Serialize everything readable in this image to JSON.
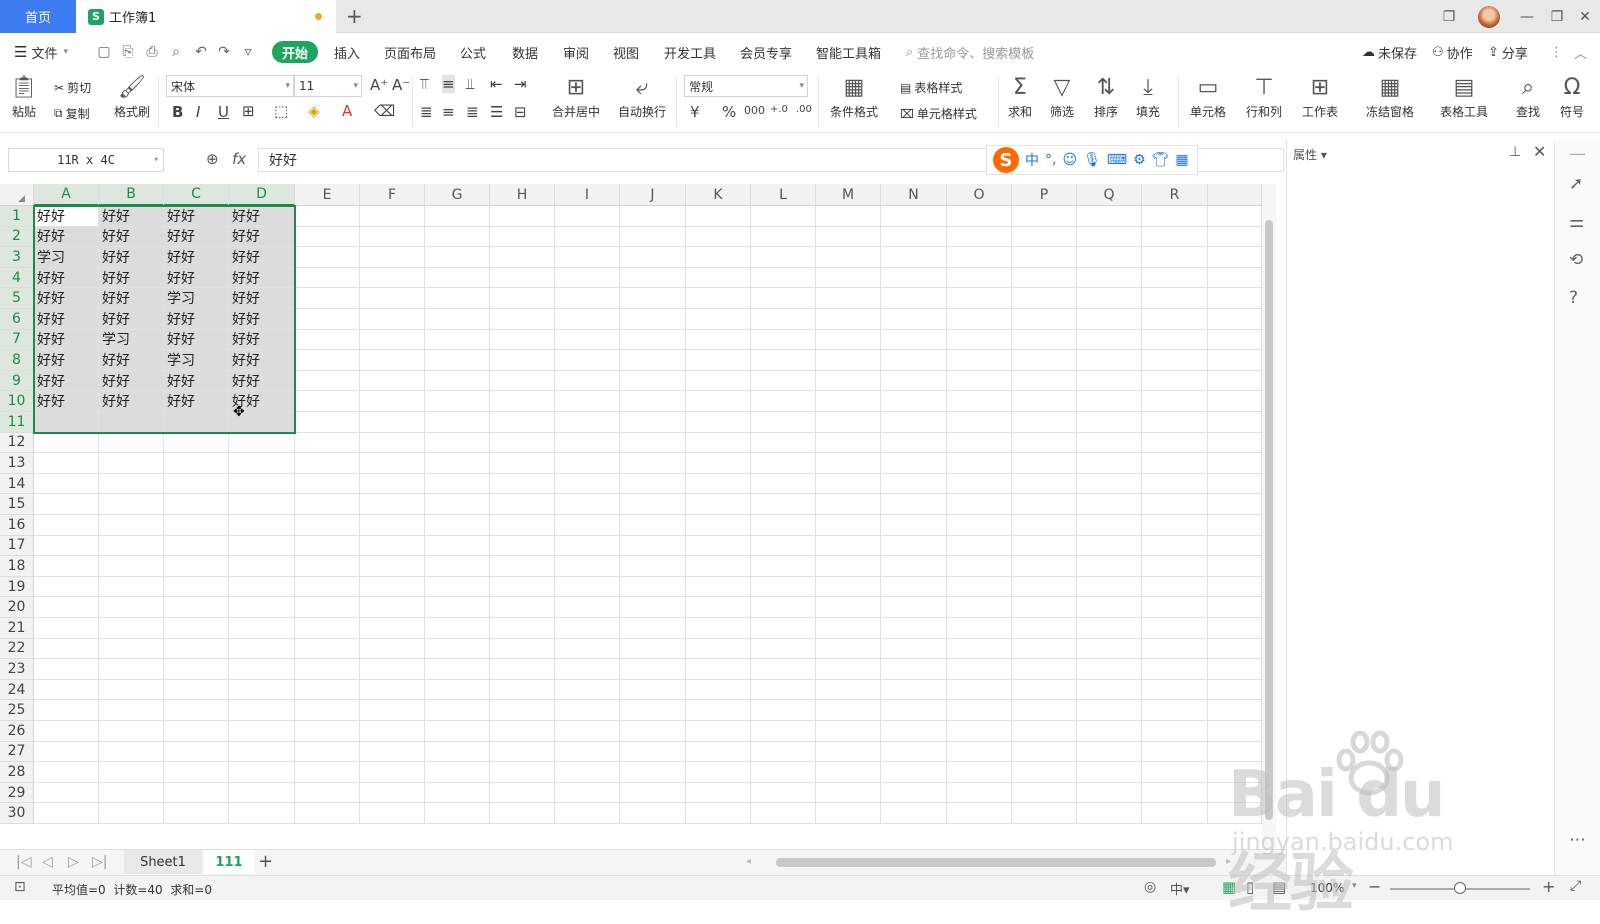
{
  "tabs": {
    "home": "首页",
    "doc": "工作簿1"
  },
  "menu": {
    "file": "文件",
    "items": [
      "开始",
      "插入",
      "页面布局",
      "公式",
      "数据",
      "审阅",
      "视图",
      "开发工具",
      "会员专享",
      "智能工具箱"
    ],
    "search_placeholder": "查找命令、搜索模板",
    "unsaved": "未保存",
    "collab": "协作",
    "share": "分享"
  },
  "ribbon": {
    "paste": "粘贴",
    "cut": "剪切",
    "copy": "复制",
    "format_painter": "格式刷",
    "font_name": "宋体",
    "font_size": "11",
    "number_format": "常规",
    "merge_center": "合并居中",
    "wrap": "自动换行",
    "cond_format": "条件格式",
    "table_style": "表格样式",
    "cell_style": "单元格样式",
    "sum": "求和",
    "filter": "筛选",
    "sort": "排序",
    "fill": "填充",
    "cell": "单元格",
    "row_col": "行和列",
    "worksheet": "工作表",
    "freeze": "冻结窗格",
    "table_tools": "表格工具",
    "find": "查找",
    "symbol": "符号"
  },
  "formula_bar": {
    "name_box": "11R x 4C",
    "fx": "fx",
    "value": "好好"
  },
  "ime": {
    "mode": "中"
  },
  "columns": [
    "A",
    "B",
    "C",
    "D",
    "E",
    "F",
    "G",
    "H",
    "I",
    "J",
    "K",
    "L",
    "M",
    "N",
    "O",
    "P",
    "Q",
    "R"
  ],
  "row_numbers": [
    "1",
    "2",
    "3",
    "4",
    "5",
    "6",
    "7",
    "8",
    "9",
    "10",
    "11",
    "12",
    "13",
    "14",
    "15",
    "16",
    "17",
    "18",
    "19",
    "20",
    "21",
    "22",
    "23",
    "24",
    "25",
    "26",
    "27",
    "28",
    "29",
    "30"
  ],
  "cells": [
    [
      "好好",
      "好好",
      "好好",
      "好好"
    ],
    [
      "好好",
      "好好",
      "好好",
      "好好"
    ],
    [
      "学习",
      "好好",
      "好好",
      "好好"
    ],
    [
      "好好",
      "好好",
      "好好",
      "好好"
    ],
    [
      "好好",
      "好好",
      "学习",
      "好好"
    ],
    [
      "好好",
      "好好",
      "好好",
      "好好"
    ],
    [
      "好好",
      "学习",
      "好好",
      "好好"
    ],
    [
      "好好",
      "好好",
      "学习",
      "好好"
    ],
    [
      "好好",
      "好好",
      "好好",
      "好好"
    ],
    [
      "好好",
      "好好",
      "好好",
      "好好"
    ],
    [
      "",
      "",
      "",
      ""
    ]
  ],
  "sheets": [
    {
      "name": "Sheet1",
      "active": false
    },
    {
      "name": "111",
      "active": true
    }
  ],
  "status": {
    "summary": "平均值=0  计数=40  求和=0",
    "zoom": "100%"
  },
  "pane": {
    "title": "属性"
  },
  "watermark": {
    "brand": "Bai du 经验",
    "url": "jingyan.baidu.com"
  },
  "colors": {
    "accent": "#1ea45e",
    "home_tab": "#3d7cf0",
    "selection": "#1e8a4a"
  }
}
